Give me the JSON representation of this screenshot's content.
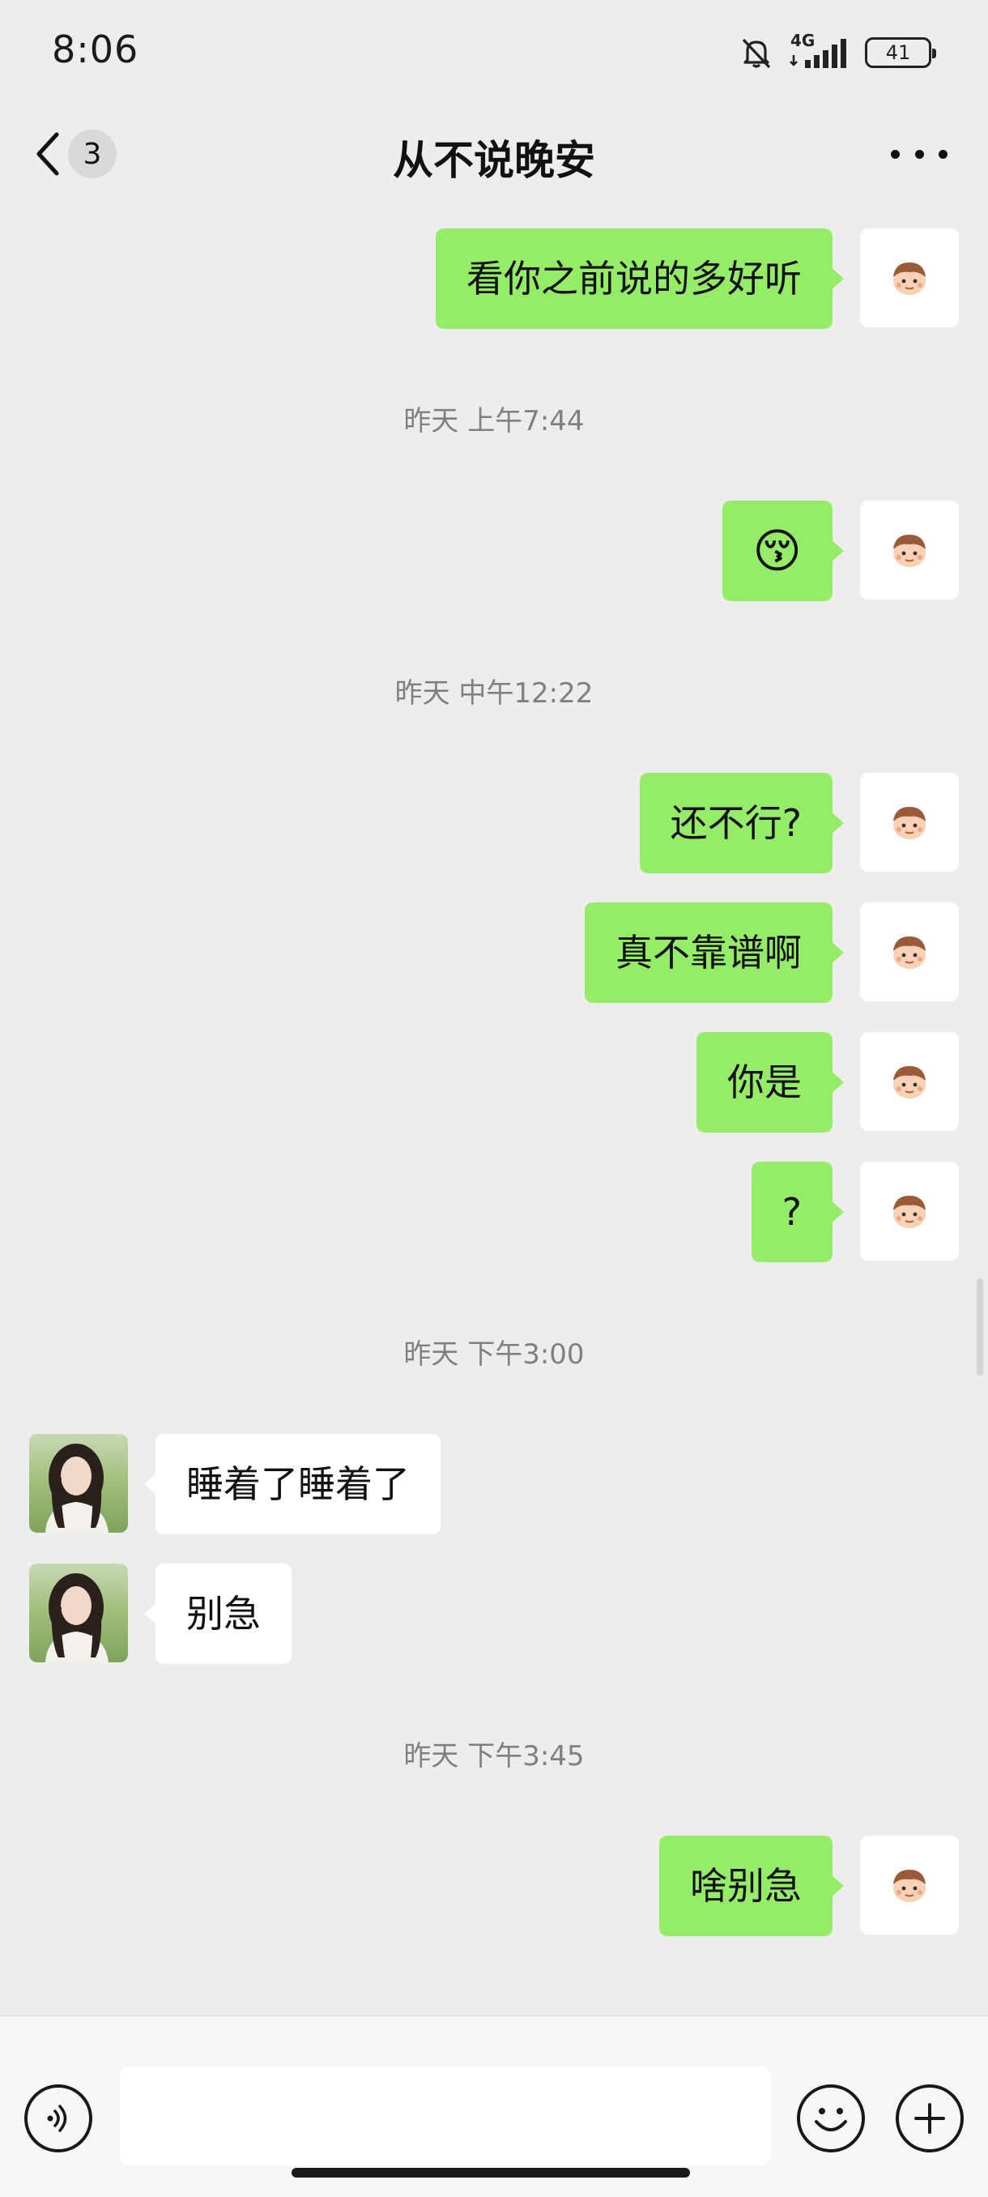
{
  "status_bar": {
    "time": "8:06",
    "network": "4G",
    "battery": "41",
    "icons": [
      "bell-muted-icon",
      "signal-icon",
      "battery-icon"
    ]
  },
  "nav": {
    "back_icon": "chevron-left-icon",
    "unread_count": "3",
    "title": "从不说晚安",
    "more_icon": "more-dots-icon"
  },
  "messages": [
    {
      "type": "text",
      "from": "me",
      "text": "看你之前说的多好听"
    },
    {
      "type": "time",
      "text": "昨天 上午7:44"
    },
    {
      "type": "emoji",
      "from": "me",
      "text": "😚"
    },
    {
      "type": "time",
      "text": "昨天 中午12:22"
    },
    {
      "type": "text",
      "from": "me",
      "text": "还不行?"
    },
    {
      "type": "text",
      "from": "me",
      "text": "真不靠谱啊"
    },
    {
      "type": "text",
      "from": "me",
      "text": "你是"
    },
    {
      "type": "text",
      "from": "me",
      "text": "?"
    },
    {
      "type": "time",
      "text": "昨天 下午3:00"
    },
    {
      "type": "text",
      "from": "her",
      "text": "睡着了睡着了"
    },
    {
      "type": "text",
      "from": "her",
      "text": "别急"
    },
    {
      "type": "time",
      "text": "昨天 下午3:45"
    },
    {
      "type": "text",
      "from": "me",
      "text": "啥别急"
    }
  ],
  "composer": {
    "input_value": "",
    "icons": [
      "voice-icon",
      "emoji-icon",
      "plus-icon"
    ]
  },
  "colors": {
    "background": "#ededed",
    "outgoing_bubble": "#95ec69",
    "incoming_bubble": "#ffffff",
    "timestamp_text": "#808080"
  }
}
